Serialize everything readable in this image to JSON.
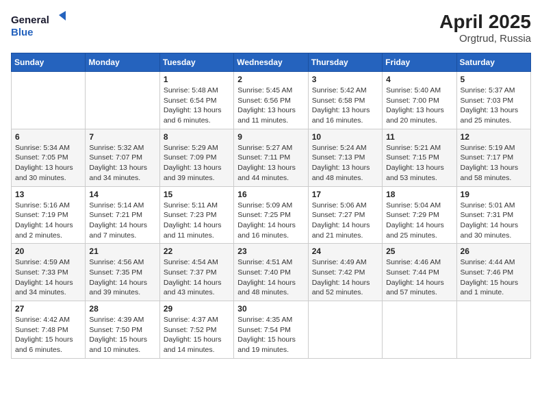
{
  "header": {
    "logo_line1": "General",
    "logo_line2": "Blue",
    "month_year": "April 2025",
    "location": "Orgtrud, Russia"
  },
  "weekdays": [
    "Sunday",
    "Monday",
    "Tuesday",
    "Wednesday",
    "Thursday",
    "Friday",
    "Saturday"
  ],
  "weeks": [
    [
      null,
      null,
      {
        "day": 1,
        "sunrise": "5:48 AM",
        "sunset": "6:54 PM",
        "daylight": "13 hours and 6 minutes."
      },
      {
        "day": 2,
        "sunrise": "5:45 AM",
        "sunset": "6:56 PM",
        "daylight": "13 hours and 11 minutes."
      },
      {
        "day": 3,
        "sunrise": "5:42 AM",
        "sunset": "6:58 PM",
        "daylight": "13 hours and 16 minutes."
      },
      {
        "day": 4,
        "sunrise": "5:40 AM",
        "sunset": "7:00 PM",
        "daylight": "13 hours and 20 minutes."
      },
      {
        "day": 5,
        "sunrise": "5:37 AM",
        "sunset": "7:03 PM",
        "daylight": "13 hours and 25 minutes."
      }
    ],
    [
      {
        "day": 6,
        "sunrise": "5:34 AM",
        "sunset": "7:05 PM",
        "daylight": "13 hours and 30 minutes."
      },
      {
        "day": 7,
        "sunrise": "5:32 AM",
        "sunset": "7:07 PM",
        "daylight": "13 hours and 34 minutes."
      },
      {
        "day": 8,
        "sunrise": "5:29 AM",
        "sunset": "7:09 PM",
        "daylight": "13 hours and 39 minutes."
      },
      {
        "day": 9,
        "sunrise": "5:27 AM",
        "sunset": "7:11 PM",
        "daylight": "13 hours and 44 minutes."
      },
      {
        "day": 10,
        "sunrise": "5:24 AM",
        "sunset": "7:13 PM",
        "daylight": "13 hours and 48 minutes."
      },
      {
        "day": 11,
        "sunrise": "5:21 AM",
        "sunset": "7:15 PM",
        "daylight": "13 hours and 53 minutes."
      },
      {
        "day": 12,
        "sunrise": "5:19 AM",
        "sunset": "7:17 PM",
        "daylight": "13 hours and 58 minutes."
      }
    ],
    [
      {
        "day": 13,
        "sunrise": "5:16 AM",
        "sunset": "7:19 PM",
        "daylight": "14 hours and 2 minutes."
      },
      {
        "day": 14,
        "sunrise": "5:14 AM",
        "sunset": "7:21 PM",
        "daylight": "14 hours and 7 minutes."
      },
      {
        "day": 15,
        "sunrise": "5:11 AM",
        "sunset": "7:23 PM",
        "daylight": "14 hours and 11 minutes."
      },
      {
        "day": 16,
        "sunrise": "5:09 AM",
        "sunset": "7:25 PM",
        "daylight": "14 hours and 16 minutes."
      },
      {
        "day": 17,
        "sunrise": "5:06 AM",
        "sunset": "7:27 PM",
        "daylight": "14 hours and 21 minutes."
      },
      {
        "day": 18,
        "sunrise": "5:04 AM",
        "sunset": "7:29 PM",
        "daylight": "14 hours and 25 minutes."
      },
      {
        "day": 19,
        "sunrise": "5:01 AM",
        "sunset": "7:31 PM",
        "daylight": "14 hours and 30 minutes."
      }
    ],
    [
      {
        "day": 20,
        "sunrise": "4:59 AM",
        "sunset": "7:33 PM",
        "daylight": "14 hours and 34 minutes."
      },
      {
        "day": 21,
        "sunrise": "4:56 AM",
        "sunset": "7:35 PM",
        "daylight": "14 hours and 39 minutes."
      },
      {
        "day": 22,
        "sunrise": "4:54 AM",
        "sunset": "7:37 PM",
        "daylight": "14 hours and 43 minutes."
      },
      {
        "day": 23,
        "sunrise": "4:51 AM",
        "sunset": "7:40 PM",
        "daylight": "14 hours and 48 minutes."
      },
      {
        "day": 24,
        "sunrise": "4:49 AM",
        "sunset": "7:42 PM",
        "daylight": "14 hours and 52 minutes."
      },
      {
        "day": 25,
        "sunrise": "4:46 AM",
        "sunset": "7:44 PM",
        "daylight": "14 hours and 57 minutes."
      },
      {
        "day": 26,
        "sunrise": "4:44 AM",
        "sunset": "7:46 PM",
        "daylight": "15 hours and 1 minute."
      }
    ],
    [
      {
        "day": 27,
        "sunrise": "4:42 AM",
        "sunset": "7:48 PM",
        "daylight": "15 hours and 6 minutes."
      },
      {
        "day": 28,
        "sunrise": "4:39 AM",
        "sunset": "7:50 PM",
        "daylight": "15 hours and 10 minutes."
      },
      {
        "day": 29,
        "sunrise": "4:37 AM",
        "sunset": "7:52 PM",
        "daylight": "15 hours and 14 minutes."
      },
      {
        "day": 30,
        "sunrise": "4:35 AM",
        "sunset": "7:54 PM",
        "daylight": "15 hours and 19 minutes."
      },
      null,
      null,
      null
    ]
  ]
}
